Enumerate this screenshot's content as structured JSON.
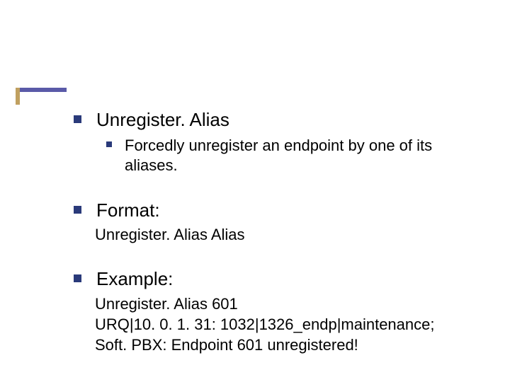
{
  "items": [
    {
      "label": "Unregister. Alias",
      "sub": [
        "Forcedly unregister an endpoint by one of its aliases."
      ]
    },
    {
      "label": "Format:",
      "body": [
        "Unregister. Alias Alias"
      ]
    },
    {
      "label": "Example:",
      "body": [
        "Unregister. Alias 601",
        "URQ|10. 0. 1. 31: 1032|1326_endp|maintenance;",
        "Soft. PBX: Endpoint 601 unregistered!"
      ]
    }
  ]
}
